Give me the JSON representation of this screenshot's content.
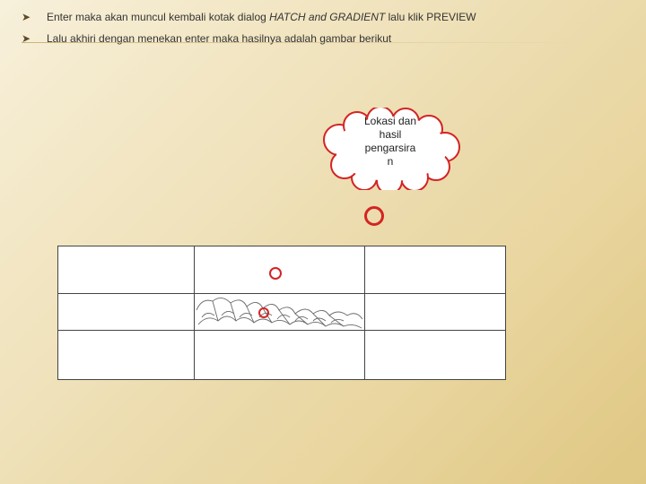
{
  "bullets": [
    {
      "pre": "Enter maka akan muncul kembali kotak dialog ",
      "italic": "HATCH and GRADIENT",
      "post": "  lalu klik PREVIEW"
    },
    {
      "pre": "Lalu akhiri dengan menekan enter maka hasilnya adalah gambar berikut",
      "italic": "",
      "post": ""
    }
  ],
  "cloud": {
    "line1": "Lokasi dan",
    "line2": "hasil",
    "line3": "pengarsira",
    "line4": "n"
  },
  "glyphs": {
    "bullet": "➤"
  }
}
